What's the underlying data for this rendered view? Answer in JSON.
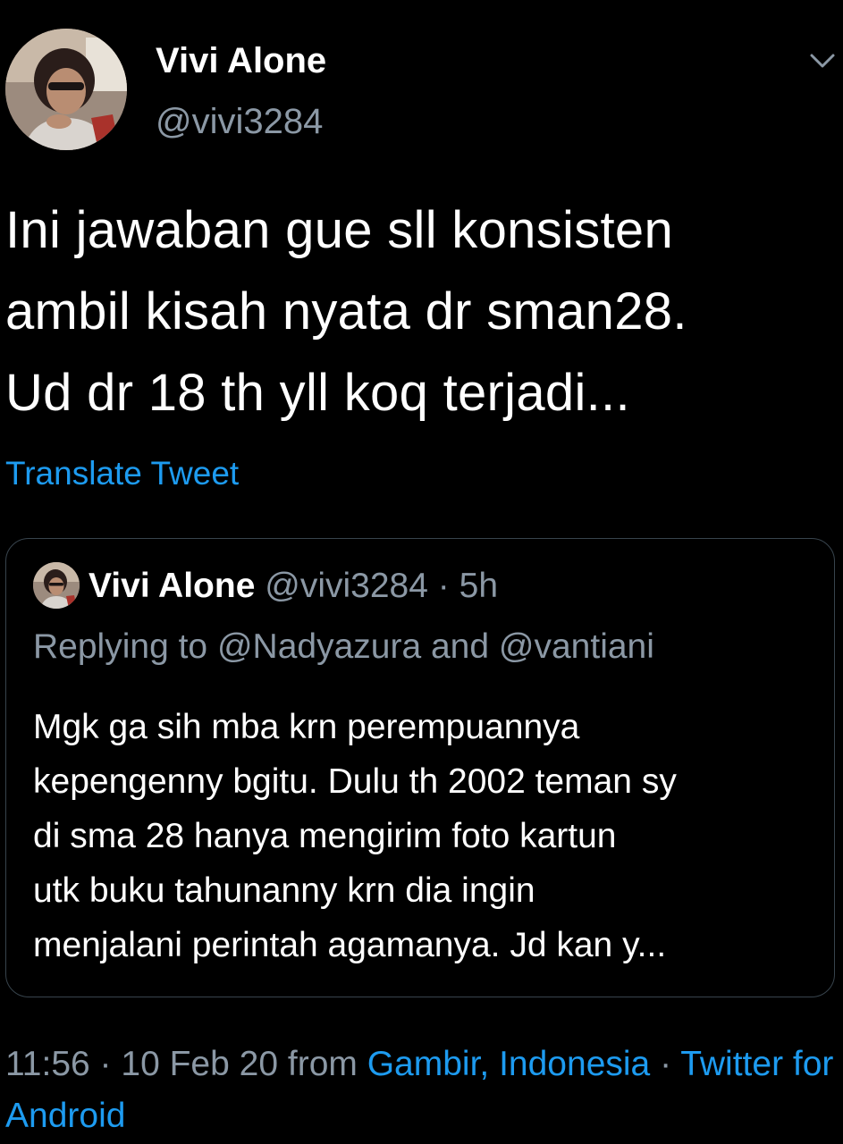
{
  "author": {
    "display_name": "Vivi Alone",
    "handle": "@vivi3284"
  },
  "tweet": {
    "text": "Ini jawaban gue sll konsisten\nambil kisah nyata dr sman28.\nUd dr 18 th yll koq terjadi...",
    "translate_label": "Translate Tweet"
  },
  "quoted_tweet": {
    "display_name": "Vivi Alone",
    "handle": "@vivi3284",
    "separator": "·",
    "time": "5h",
    "replying_to": "Replying to @Nadyazura and @vantiani",
    "text": "Mgk ga sih mba krn perempuannya\nkepengenny bgitu. Dulu th 2002 teman sy\ndi sma 28 hanya mengirim foto kartun\nutk buku tahunanny krn dia ingin\nmenjalani perintah agamanya. Jd kan y..."
  },
  "meta": {
    "time": "11:56",
    "sep1": "·",
    "date": "10 Feb 20",
    "from_label": "from",
    "location": "Gambir, Indonesia",
    "sep2": "·",
    "source": "Twitter for Android"
  },
  "icons": {
    "caret": "chevron-down-icon"
  },
  "colors": {
    "background": "#000000",
    "primary_text": "#ffffff",
    "secondary_text": "#8b98a5",
    "link": "#1d9bf0",
    "border": "#38444d"
  }
}
